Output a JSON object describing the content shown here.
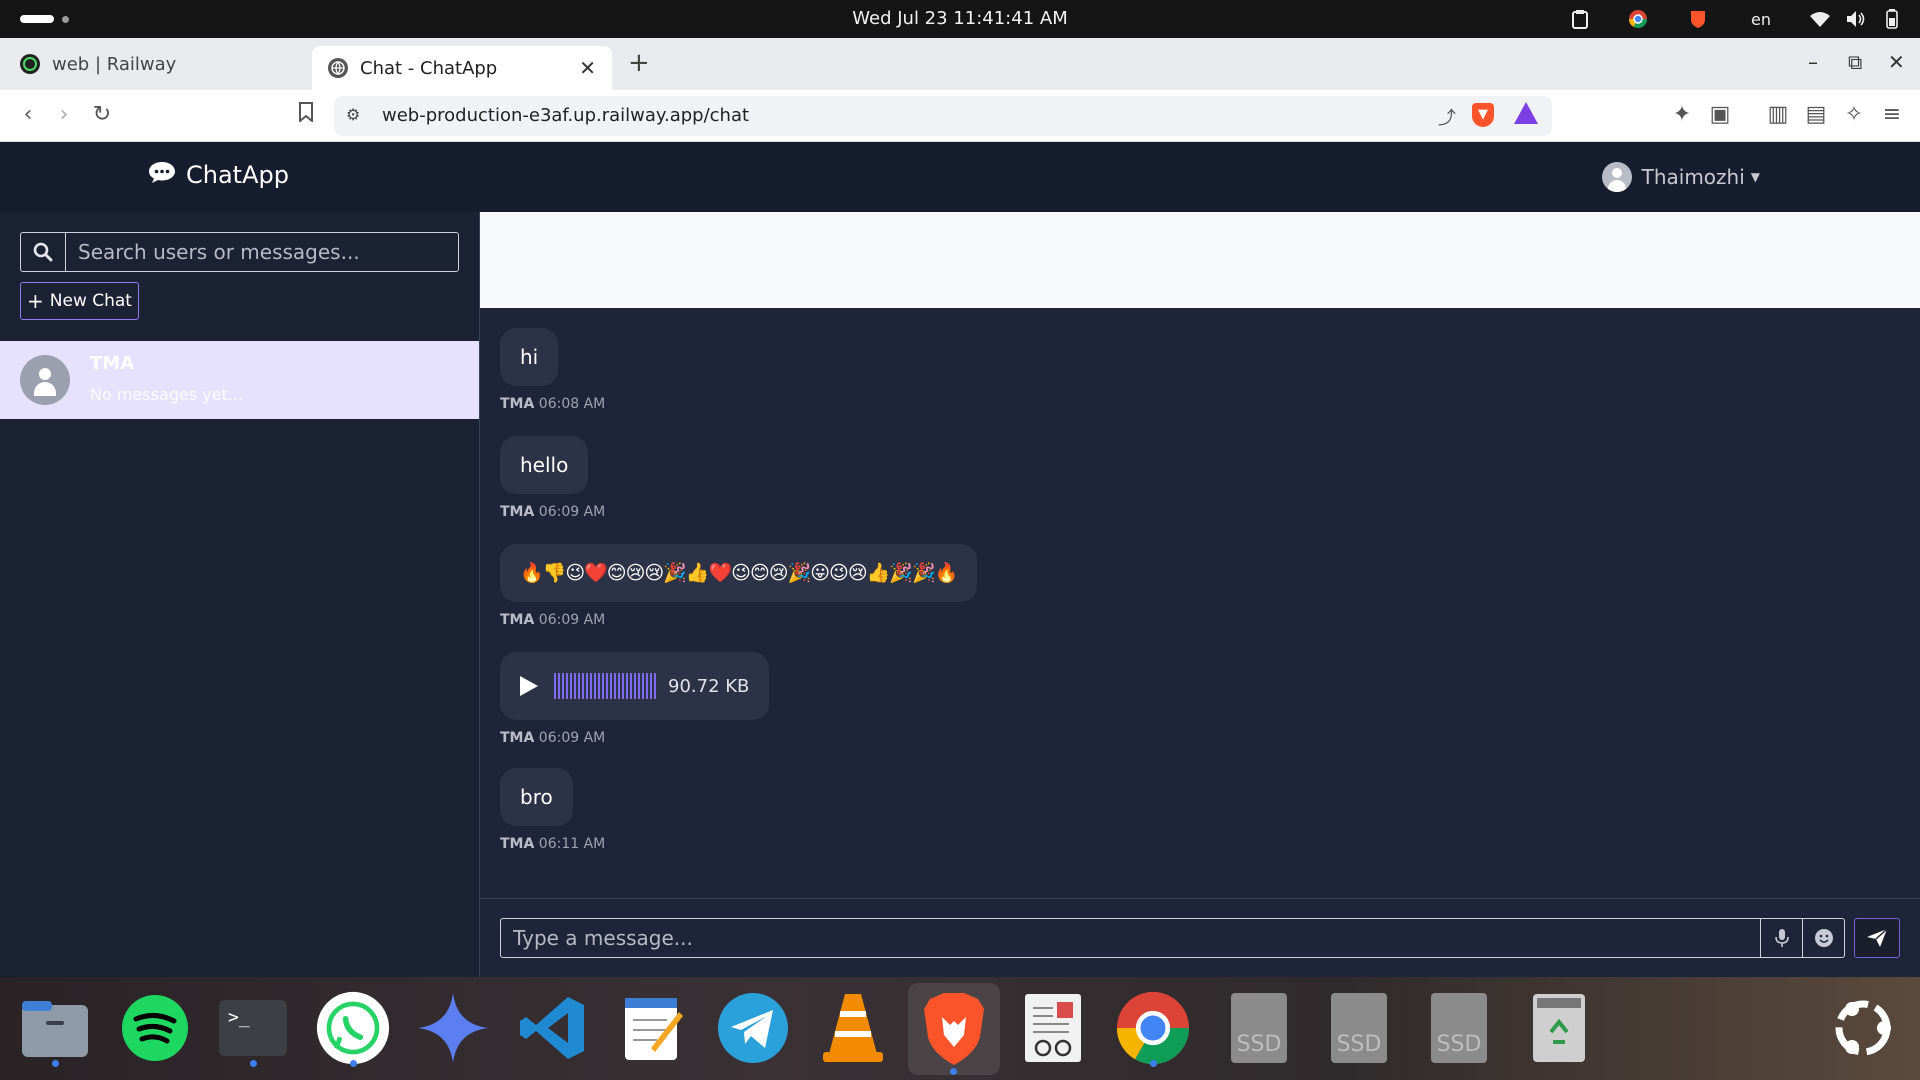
{
  "os": {
    "clock": "Wed Jul 23  11:41:41 AM",
    "language": "en",
    "tray_icons": [
      "clipboard-icon",
      "chrome-tray-icon",
      "brave-tray-icon",
      "wifi-icon",
      "volume-icon",
      "battery-icon"
    ]
  },
  "browser": {
    "tabs": [
      {
        "label": "web | Railway",
        "icon": "railway-icon",
        "active": false
      },
      {
        "label": "Chat - ChatApp",
        "icon": "globe-icon",
        "active": true
      }
    ],
    "url": "web-production-e3af.up.railway.app/chat"
  },
  "app": {
    "brand": "ChatApp",
    "user_name": "Thaimozhi",
    "search_placeholder": "Search users or messages...",
    "new_chat_label": "New Chat",
    "conversations": [
      {
        "name": "TMA",
        "preview": "No messages yet..."
      }
    ],
    "messages": [
      {
        "sender": "TMA",
        "text": "hi",
        "time": "06:08 AM"
      },
      {
        "sender": "TMA",
        "text": "hello",
        "time": "06:09 AM"
      },
      {
        "sender": "TMA",
        "text": "🔥👎😉❤️😊😢😢🎉👍❤️😉😊😢🎉😛😉😢👍🎉🎉🔥",
        "time": "06:09 AM"
      },
      {
        "sender": "TMA",
        "type": "audio",
        "size": "90.72 KB",
        "time": "06:09 AM"
      },
      {
        "sender": "TMA",
        "text": "bro",
        "time": "06:11 AM"
      }
    ],
    "composer_placeholder": "Type a message..."
  },
  "dock": {
    "items": [
      "files",
      "spotify",
      "terminal",
      "whatsapp",
      "gemini",
      "vscode",
      "text-editor",
      "telegram",
      "vlc",
      "brave",
      "document-viewer",
      "chrome",
      "ssd",
      "ssd",
      "ssd",
      "trash",
      "ubuntu"
    ],
    "ssd_label": "SSD"
  },
  "colors": {
    "accent": "#8e7cf5",
    "sidebar_bg": "#1b2234",
    "chat_bg": "#1e2538",
    "bubble_bg": "#2c3346",
    "selected_conv": "#e6e2fd"
  }
}
